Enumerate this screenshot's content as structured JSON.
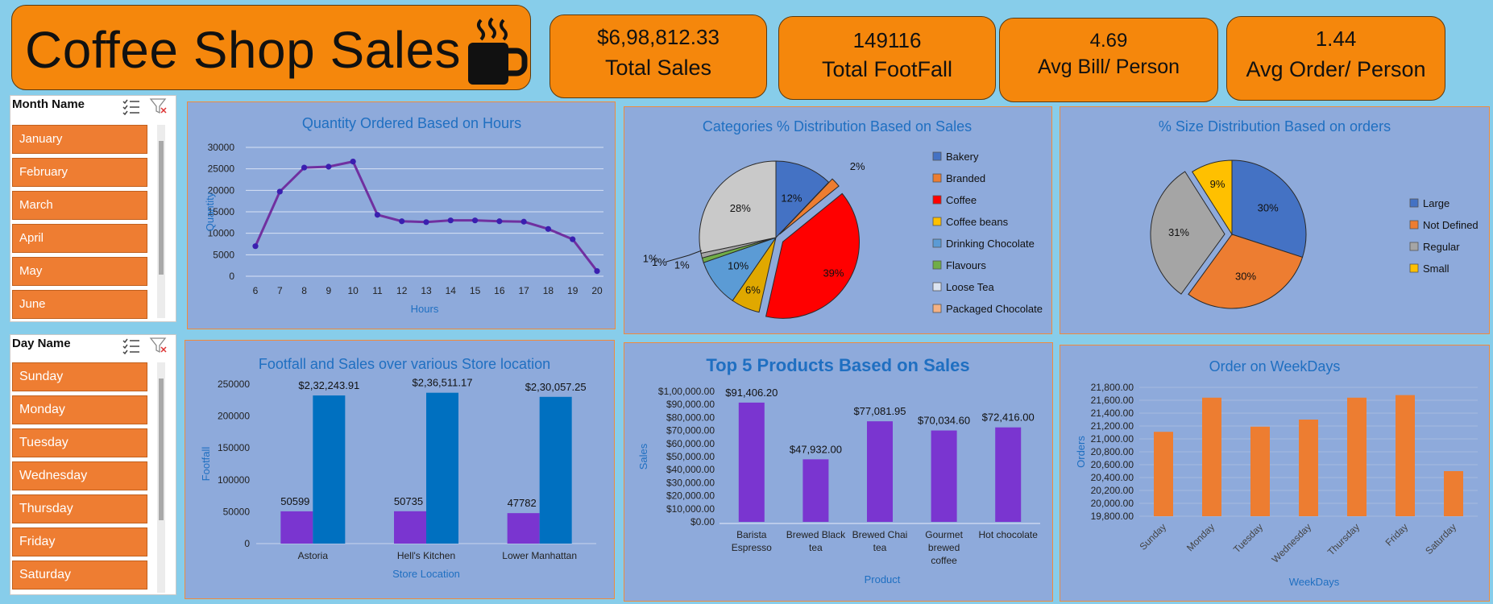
{
  "dashboard": {
    "title": "Coffee Shop Sales",
    "kpis": [
      {
        "value": "$6,98,812.33",
        "label": "Total Sales"
      },
      {
        "value": "149116",
        "label": "Total FootFall"
      },
      {
        "value": "4.69",
        "label": "Avg Bill/ Person"
      },
      {
        "value": "1.44",
        "label": "Avg Order/ Person"
      }
    ]
  },
  "slicers": {
    "month": {
      "header": "Month Name",
      "items": [
        "January",
        "February",
        "March",
        "April",
        "May",
        "June"
      ]
    },
    "day": {
      "header": "Day Name",
      "items": [
        "Sunday",
        "Monday",
        "Tuesday",
        "Wednesday",
        "Thursday",
        "Friday",
        "Saturday"
      ]
    }
  },
  "colors": {
    "orange_card": "#f5870c",
    "slicer_item": "#ee7d32",
    "panel_bg": "#8eaadb",
    "title_blue": "#1f6fc1",
    "line": "#7030a0",
    "bar_purple": "#7a35d0",
    "bar_blue": "#0070c0",
    "bar_orange": "#ed7d31"
  },
  "chart_data": [
    {
      "type": "line",
      "title": "Quantity Ordered Based on Hours",
      "xlabel": "Hours",
      "ylabel": "Quantity",
      "x": [
        6,
        7,
        8,
        9,
        10,
        11,
        12,
        13,
        14,
        15,
        16,
        17,
        18,
        19,
        20
      ],
      "values": [
        7000,
        19700,
        25300,
        25500,
        26700,
        14300,
        12800,
        12600,
        13000,
        13000,
        12800,
        12700,
        11000,
        8600,
        1200
      ],
      "yticks": [
        "0",
        "5000",
        "10000",
        "15000",
        "20000",
        "25000",
        "30000"
      ],
      "ylim": [
        0,
        30000
      ],
      "grid": true
    },
    {
      "type": "pie",
      "title": "Categories % Distribution Based on Sales",
      "categories": [
        "Bakery",
        "Branded",
        "Coffee",
        "Coffee beans",
        "Drinking Chocolate",
        "Flavours",
        "Loose Tea",
        "Packaged Chocolate"
      ],
      "values": [
        12,
        2,
        39,
        6,
        10,
        1,
        1,
        28
      ],
      "labels": [
        "12%",
        "2%",
        "39%",
        "6%",
        "10%",
        "1%",
        "1%",
        "28%"
      ],
      "extra_label": "1%",
      "colors": [
        "#4472c4",
        "#ed7d31",
        "#ff0000",
        "#e0a800",
        "#5b9bd5",
        "#70ad47",
        "#a5a5a5",
        "#c9c9c9"
      ],
      "legend_colors": [
        "#4472c4",
        "#ed7d31",
        "#ff0000",
        "#ffc000",
        "#5b9bd5",
        "#70ad47",
        "#dbe3f0",
        "#f4b183"
      ],
      "legend": "right"
    },
    {
      "type": "pie",
      "title": "% Size Distribution Based on orders",
      "categories": [
        "Large",
        "Not Defined",
        "Regular",
        "Small"
      ],
      "values": [
        30,
        30,
        31,
        9
      ],
      "labels": [
        "30%",
        "30%",
        "31%",
        "9%"
      ],
      "colors": [
        "#4472c4",
        "#ed7d31",
        "#a5a5a5",
        "#ffc000"
      ],
      "legend": "right"
    },
    {
      "type": "bar",
      "title": "Footfall and Sales over various Store location",
      "xlabel": "Store Location",
      "ylabel": "Footfall",
      "categories": [
        "Astoria",
        "Hell's Kitchen",
        "Lower Manhattan"
      ],
      "series": [
        {
          "values": [
            50599,
            50735,
            47782
          ],
          "labels": [
            "50599",
            "50735",
            "47782"
          ]
        },
        {
          "values": [
            232243.91,
            236511.17,
            230057.25
          ],
          "labels": [
            "$2,32,243.91",
            "$2,36,511.17",
            "$2,30,057.25"
          ]
        }
      ],
      "yticks": [
        "0",
        "50000",
        "100000",
        "150000",
        "200000",
        "250000"
      ],
      "ylim": [
        0,
        250000
      ]
    },
    {
      "type": "bar",
      "title": "Top 5 Products Based on Sales",
      "xlabel": "Product",
      "ylabel": "Sales",
      "categories": [
        [
          "Barista",
          "Espresso"
        ],
        [
          "Brewed Black",
          "tea"
        ],
        [
          "Brewed Chai",
          "tea"
        ],
        [
          "Gourmet",
          "brewed",
          "coffee"
        ],
        [
          "Hot chocolate"
        ]
      ],
      "values": [
        91406.2,
        47932.0,
        77081.95,
        70034.6,
        72416.0
      ],
      "labels": [
        "$91,406.20",
        "$47,932.00",
        "$77,081.95",
        "$70,034.60",
        "$72,416.00"
      ],
      "yticks": [
        "$0.00",
        "$10,000.00",
        "$20,000.00",
        "$30,000.00",
        "$40,000.00",
        "$50,000.00",
        "$60,000.00",
        "$70,000.00",
        "$80,000.00",
        "$90,000.00",
        "$1,00,000.00"
      ],
      "ylim": [
        0,
        100000
      ]
    },
    {
      "type": "bar",
      "title": "Order on WeekDays",
      "xlabel": "WeekDays",
      "ylabel": "Orders",
      "categories": [
        "Sunday",
        "Monday",
        "Tuesday",
        "Wednesday",
        "Thursday",
        "Friday",
        "Saturday"
      ],
      "values": [
        21110,
        21640,
        21190,
        21300,
        21640,
        21680,
        20500
      ],
      "yticks": [
        "19,800.00",
        "20,000.00",
        "20,200.00",
        "20,400.00",
        "20,600.00",
        "20,800.00",
        "21,000.00",
        "21,200.00",
        "21,400.00",
        "21,600.00",
        "21,800.00"
      ],
      "ylim": [
        19800,
        21800
      ]
    }
  ]
}
